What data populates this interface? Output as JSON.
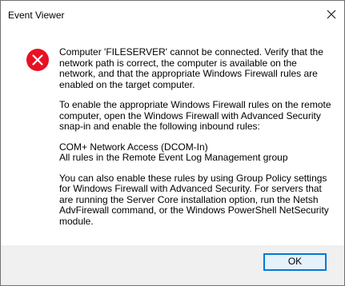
{
  "window": {
    "title": "Event Viewer",
    "close_icon": "close-icon"
  },
  "message": {
    "icon": "error-icon",
    "icon_color": "#e81123",
    "paragraph1": "Computer 'FILESERVER' cannot be connected. Verify that the network path is correct, the computer is available on the network, and that the appropriate Windows Firewall rules are enabled on the target computer.",
    "paragraph2": "To enable the appropriate Windows Firewall rules on the remote computer, open the Windows Firewall with Advanced Security snap-in and enable the following inbound rules:",
    "rule1": "COM+ Network Access (DCOM-In)",
    "rule2": "All rules in the Remote Event Log Management group",
    "paragraph3": "You can also enable these rules by using Group Policy settings for Windows Firewall with Advanced Security. For servers that are running the Server Core installation option, run the Netsh AdvFirewall command, or the Windows PowerShell NetSecurity module."
  },
  "footer": {
    "ok_label": "OK",
    "accent_color": "#0078d7",
    "background": "#f0f0f0"
  }
}
